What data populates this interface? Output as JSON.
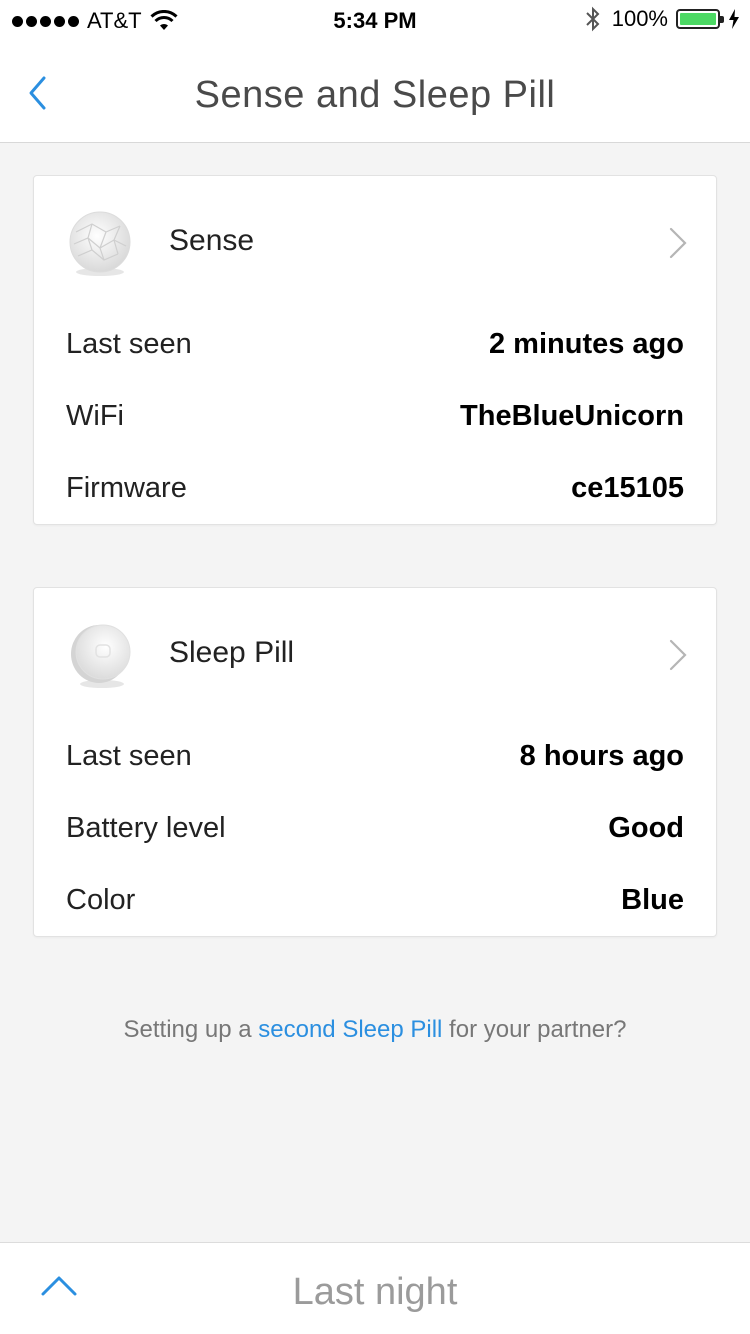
{
  "status_bar": {
    "carrier": "AT&T",
    "time": "5:34 PM",
    "battery_percent": "100%",
    "battery_level": 1.0,
    "battery_color": "#4cd964"
  },
  "nav": {
    "title": "Sense and Sleep Pill",
    "back_icon": "chevron-left-icon",
    "accent_color": "#2b8fe0"
  },
  "devices": [
    {
      "name": "Sense",
      "icon": "sense-device-icon",
      "rows": [
        {
          "label": "Last seen",
          "value": "2 minutes ago"
        },
        {
          "label": "WiFi",
          "value": "TheBlueUnicorn"
        },
        {
          "label": "Firmware",
          "value": "ce15105"
        }
      ]
    },
    {
      "name": "Sleep Pill",
      "icon": "sleep-pill-device-icon",
      "rows": [
        {
          "label": "Last seen",
          "value": "8 hours ago"
        },
        {
          "label": "Battery level",
          "value": "Good"
        },
        {
          "label": "Color",
          "value": "Blue"
        }
      ]
    }
  ],
  "partner_prompt": {
    "prefix": "Setting up a ",
    "link": "second Sleep Pill",
    "suffix": " for your partner?"
  },
  "bottom_bar": {
    "title": "Last night",
    "icon": "chevron-up-icon"
  }
}
